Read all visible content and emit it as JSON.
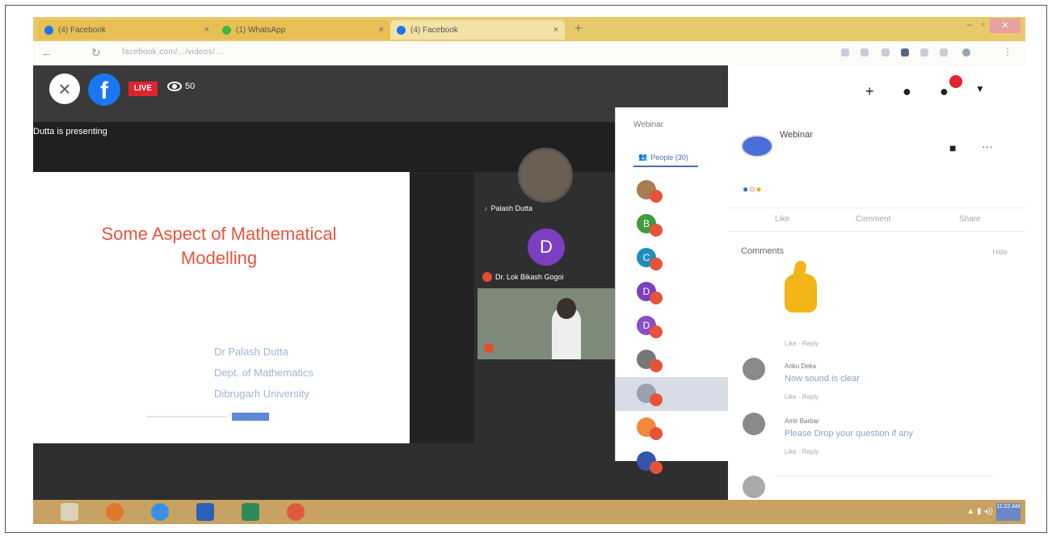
{
  "browser": {
    "tabs": [
      {
        "title": "(4) Facebook",
        "active": false
      },
      {
        "title": "(1) WhatsApp",
        "active": false
      },
      {
        "title": "(4) Facebook",
        "active": true
      }
    ],
    "url": "facebook.com/.../videos/..."
  },
  "live": {
    "badge": "LIVE",
    "viewers": "50",
    "presenting": "Dutta is presenting"
  },
  "slide": {
    "title_line1": "Some Aspect of Mathematical",
    "title_line2": "Modelling",
    "author_lines": [
      "Dr Palash Dutta",
      "Dept. of Mathematics",
      "Dibrugarh University"
    ]
  },
  "participants": {
    "tile1_name": "Palash Dutta",
    "tile2_initial": "D",
    "tile2_name": "Dr. Lok Bikash Gogoi"
  },
  "people_panel": {
    "title": "Webinar",
    "tab_label": "People (30)",
    "rows": [
      {
        "initial": "",
        "color": "#a67c52",
        "selected": false
      },
      {
        "initial": "B",
        "color": "#3f9c3a",
        "selected": false
      },
      {
        "initial": "C",
        "color": "#1f8fb8",
        "selected": false
      },
      {
        "initial": "D",
        "color": "#7b3fbf",
        "selected": false
      },
      {
        "initial": "D",
        "color": "#8a4fc4",
        "selected": false
      },
      {
        "initial": "",
        "color": "#777777",
        "selected": false
      },
      {
        "initial": "",
        "color": "#9aa0ad",
        "selected": true
      },
      {
        "initial": "",
        "color": "#f08a3a",
        "selected": false
      },
      {
        "initial": "",
        "color": "#3355aa",
        "selected": false
      }
    ]
  },
  "post": {
    "title": "Webinar",
    "actions": {
      "like": "Like",
      "comment": "Comment",
      "share": "Share"
    },
    "comments_heading": "Comments",
    "hide_label": "Hide"
  },
  "comments": [
    {
      "name": "Anku Deka",
      "text": "Now sound is clear",
      "meta": "Like · Reply"
    },
    {
      "name": "Amir Barbar",
      "text": "Please Drop your question if any",
      "meta": "Like · Reply"
    }
  ],
  "sticker_meta": "Like · Reply",
  "taskbar": {
    "clock": "11:22 AM"
  },
  "colors": {
    "facebook_blue": "#1877f2",
    "live_red": "#e0242e",
    "slide_title": "#e8553e"
  }
}
